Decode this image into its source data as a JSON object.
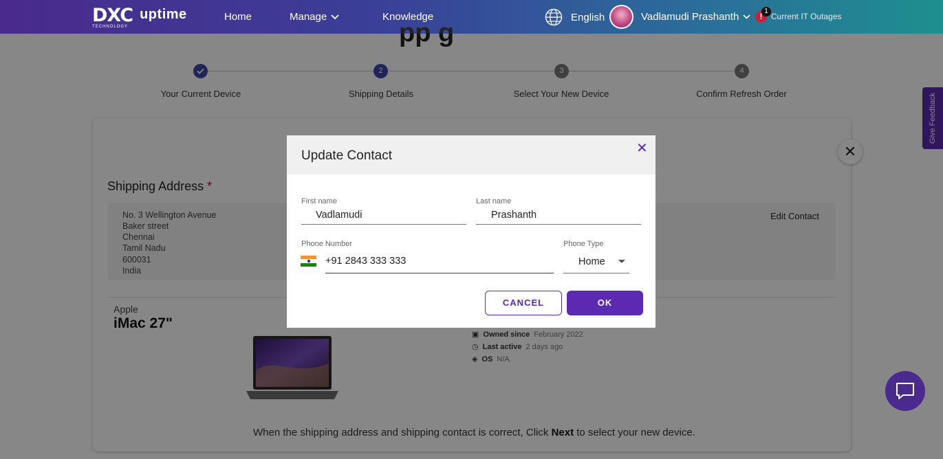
{
  "header": {
    "logo_main": "DXC",
    "logo_sub": "TECHNOLOGY",
    "logo_product": "uptime",
    "nav": [
      "Home",
      "Manage",
      "Knowledge"
    ],
    "language": "English",
    "user_name": "Vadlamudi Prashanth",
    "alert_count": "1",
    "outages_label": "Current IT Outages"
  },
  "page": {
    "title_partial": "pp g",
    "steps": [
      {
        "number": "1",
        "label": "Your Current Device",
        "state": "done"
      },
      {
        "number": "2",
        "label": "Shipping Details",
        "state": "active"
      },
      {
        "number": "3",
        "label": "Select Your New Device",
        "state": "pending"
      },
      {
        "number": "4",
        "label": "Confirm Refresh Order",
        "state": "pending"
      }
    ],
    "shipping_title": "Shipping Address",
    "required_mark": "*",
    "address_lines": [
      "No. 3 Wellington Avenue",
      "Baker street",
      "Chennai",
      "Tamil Nadu",
      "600031",
      "India"
    ],
    "edit_contact_label": "Edit Contact",
    "device": {
      "brand": "Apple",
      "model": "iMac 27\"",
      "owned_since_label": "Owned since",
      "owned_since": "February 2022",
      "last_active_label": "Last active",
      "last_active": "2 days ago",
      "os_label": "OS",
      "os": "N/A"
    },
    "note_before": "When the shipping address and shipping contact is correct, Click ",
    "note_bold": "Next",
    "note_after": " to select your new device.",
    "feedback_label": "Give Feedback"
  },
  "modal": {
    "title": "Update Contact",
    "first_name_label": "First name",
    "first_name": "Vadlamudi",
    "last_name_label": "Last name",
    "last_name": "Prashanth",
    "phone_label": "Phone Number",
    "phone": "+91 2843 333 333",
    "phone_type_label": "Phone Type",
    "phone_type": "Home",
    "cancel_label": "CANCEL",
    "ok_label": "OK"
  },
  "colors": {
    "accent": "#5b2ab0",
    "step_done": "#3b47a8",
    "step_pending": "#7a7a7a"
  }
}
